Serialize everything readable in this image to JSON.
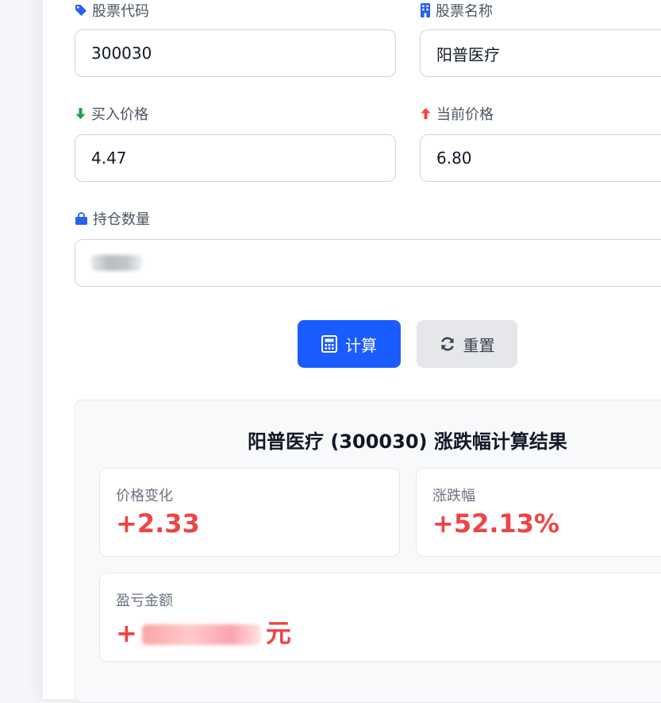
{
  "form": {
    "stock_code": {
      "label": "股票代码",
      "value": "300030"
    },
    "stock_name": {
      "label": "股票名称",
      "value": "阳普医疗"
    },
    "buy_price": {
      "label": "买入价格",
      "value": "4.47"
    },
    "current_price": {
      "label": "当前价格",
      "value": "6.80"
    },
    "quantity": {
      "label": "持仓数量",
      "value": ""
    }
  },
  "buttons": {
    "calculate": "计算",
    "reset": "重置"
  },
  "result": {
    "title": "阳普医疗 (300030) 涨跌幅计算结果",
    "price_change": {
      "label": "价格变化",
      "value": "+2.33"
    },
    "change_pct": {
      "label": "涨跌幅",
      "value": "+52.13%"
    },
    "profit_loss": {
      "label": "盈亏金额",
      "prefix": "+",
      "unit": "元"
    }
  },
  "colors": {
    "primary": "#1a5cff",
    "gain": "#ef4444",
    "down_arrow": "#16a34a",
    "up_arrow": "#ef4444"
  },
  "icons": {
    "stock_code": "tag-icon",
    "stock_name": "building-icon",
    "buy_price": "arrow-down-icon",
    "current_price": "arrow-up-icon",
    "quantity": "shopping-bag-icon",
    "calculate": "calculator-icon",
    "reset": "refresh-icon"
  }
}
